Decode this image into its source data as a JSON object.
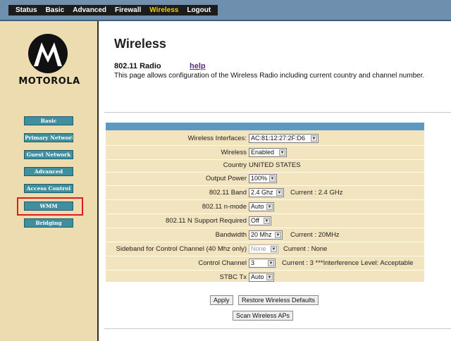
{
  "top_nav": {
    "items": [
      "Status",
      "Basic",
      "Advanced",
      "Firewall",
      "Wireless",
      "Logout"
    ],
    "active": "Wireless",
    "active_color": "#f0d000"
  },
  "brand": {
    "name": "MOTOROLA",
    "logo_icon": "motorola-batwing-icon"
  },
  "sidebar": {
    "items": [
      "Basic",
      "Primary Network",
      "Guest Network",
      "Advanced",
      "Access Control",
      "WMM",
      "Bridging"
    ],
    "highlighted": "WMM",
    "highlight_color": "#e01b1b"
  },
  "page": {
    "title": "Wireless",
    "subtitle": "802.11 Radio",
    "help_link": "help",
    "description": "This page allows configuration of the Wireless Radio including current country and channel number."
  },
  "form": {
    "wireless_interfaces": {
      "label": "Wireless Interfaces:",
      "value": "AC:81:12:27:2F:D6"
    },
    "wireless": {
      "label": "Wireless",
      "value": "Enabled"
    },
    "country": {
      "label": "Country",
      "value": "UNITED STATES"
    },
    "output_power": {
      "label": "Output Power",
      "value": "100%"
    },
    "band": {
      "label": "802.11 Band",
      "value": "2.4 Ghz",
      "current": "Current :  2.4 GHz"
    },
    "n_mode": {
      "label": "802.11 n-mode",
      "value": "Auto"
    },
    "n_support": {
      "label": "802.11 N Support Required",
      "value": "Off"
    },
    "bandwidth": {
      "label": "Bandwidth",
      "value": "20 Mhz",
      "current": "Current :  20MHz"
    },
    "sideband": {
      "label": "Sideband for Control Channel (40 Mhz only)",
      "value": "None",
      "current": "Current : None"
    },
    "control_channel": {
      "label": "Control Channel",
      "value": "3",
      "current": "Current :  3 ***Interference Level: Acceptable"
    },
    "stbc_tx": {
      "label": "STBC Tx",
      "value": "Auto"
    }
  },
  "buttons": {
    "apply": "Apply",
    "restore": "Restore Wireless Defaults",
    "scan": "Scan Wireless APs"
  }
}
